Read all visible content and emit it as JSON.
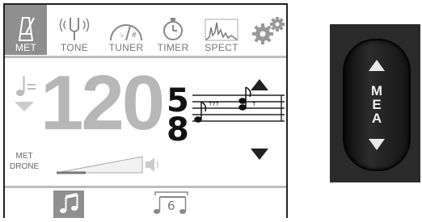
{
  "tabs": [
    {
      "label": "MET",
      "icon": "metronome-icon",
      "active": true
    },
    {
      "label": "TONE",
      "icon": "tuning-fork-icon",
      "active": false
    },
    {
      "label": "TUNER",
      "icon": "tuner-gauge-icon",
      "active": false
    },
    {
      "label": "TIMER",
      "icon": "stopwatch-icon",
      "active": false
    },
    {
      "label": "SPECT",
      "icon": "spectrum-icon",
      "active": false
    }
  ],
  "settings_icon": "gears-icon",
  "tempo": {
    "value": "120",
    "note_eq": "♩="
  },
  "time_signature": {
    "top": "5",
    "bottom": "8"
  },
  "met_drone": {
    "line1": "MET",
    "line2": "DRONE"
  },
  "bottom_bar": {
    "tuplet_number": "6"
  },
  "hardware_button": {
    "letters": [
      "M",
      "E",
      "A"
    ]
  },
  "colors": {
    "active_tab": "#8f8f8f",
    "digits": "#b7b7b7",
    "panel": "#2a2a2a"
  }
}
